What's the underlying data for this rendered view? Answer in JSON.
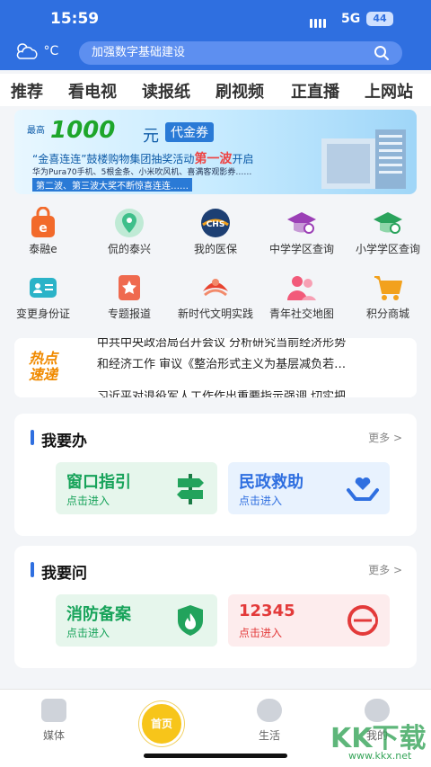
{
  "status": {
    "time": "15:59",
    "network": "5G",
    "battery": "44"
  },
  "topbar": {
    "weather_unit": "°C",
    "search_placeholder": "加强数字基础建设"
  },
  "tabs": [
    "推荐",
    "看电视",
    "读报纸",
    "刷视频",
    "正直播",
    "上网站"
  ],
  "banner": {
    "tag": "最高",
    "amount": "1000",
    "unit": "元",
    "coupon": "代金券",
    "line1_prefix": "“金喜连连”鼓楼购物集团抽奖活动",
    "line1_highlight": "第一波",
    "line1_suffix": "开启",
    "line2": "华为Pura70手机、5根金条、小米吹风机、喜满客观影券……",
    "line3": "第二波、第三波大奖不断惊喜连连……"
  },
  "grid_row1": [
    {
      "label": "泰融e",
      "icon": "shopping-bag-icon",
      "color": "#f26a2b"
    },
    {
      "label": "侃的泰兴",
      "icon": "location-pin-icon",
      "color": "#3fbf8a"
    },
    {
      "label": "我的医保",
      "icon": "chs-insurance-icon",
      "color": "#1d3f73"
    },
    {
      "label": "中学学区查询",
      "icon": "graduation-cap-icon",
      "color": "#9b3fb6"
    },
    {
      "label": "小学学区查询",
      "icon": "graduation-cap-icon",
      "color": "#2aa35c"
    }
  ],
  "grid_row2": [
    {
      "label": "变更身份证",
      "icon": "id-card-icon",
      "color": "#2bb3c8"
    },
    {
      "label": "专题报道",
      "icon": "star-doc-icon",
      "color": "#ef6a4f"
    },
    {
      "label": "新时代文明实践",
      "icon": "emblem-icon",
      "color": "#e8432f"
    },
    {
      "label": "青年社交地图",
      "icon": "people-icon",
      "color": "#f25a7a"
    },
    {
      "label": "积分商城",
      "icon": "cart-icon",
      "color": "#f2a11d"
    }
  ],
  "hot": {
    "logo_line1": "热点",
    "logo_line2": "速递",
    "news": [
      "中共中央政治局召开会议 分析研究当前经济形势",
      "和经济工作 审议《整治形式主义为基层减负若…",
      "习近平对退役军人工作作出重要指示强调 切实把"
    ]
  },
  "panel_do": {
    "title": "我要办",
    "more": "更多",
    "cards": [
      {
        "title": "窗口指引",
        "sub": "点击进入",
        "icon": "signpost-icon"
      },
      {
        "title": "民政救助",
        "sub": "点击进入",
        "icon": "heart-hands-icon"
      }
    ]
  },
  "panel_ask": {
    "title": "我要问",
    "more": "更多",
    "cards": [
      {
        "title": "消防备案",
        "sub": "点击进入",
        "icon": "fire-shield-icon"
      },
      {
        "title": "12345",
        "sub": "点击进入",
        "icon": "hotline-12345-icon"
      }
    ]
  },
  "bottom_nav": {
    "media": "媒体",
    "home": "首页",
    "life": "生活",
    "mine": "我的"
  },
  "watermark": {
    "main": "KK下载",
    "url": "www.kkx.net"
  }
}
